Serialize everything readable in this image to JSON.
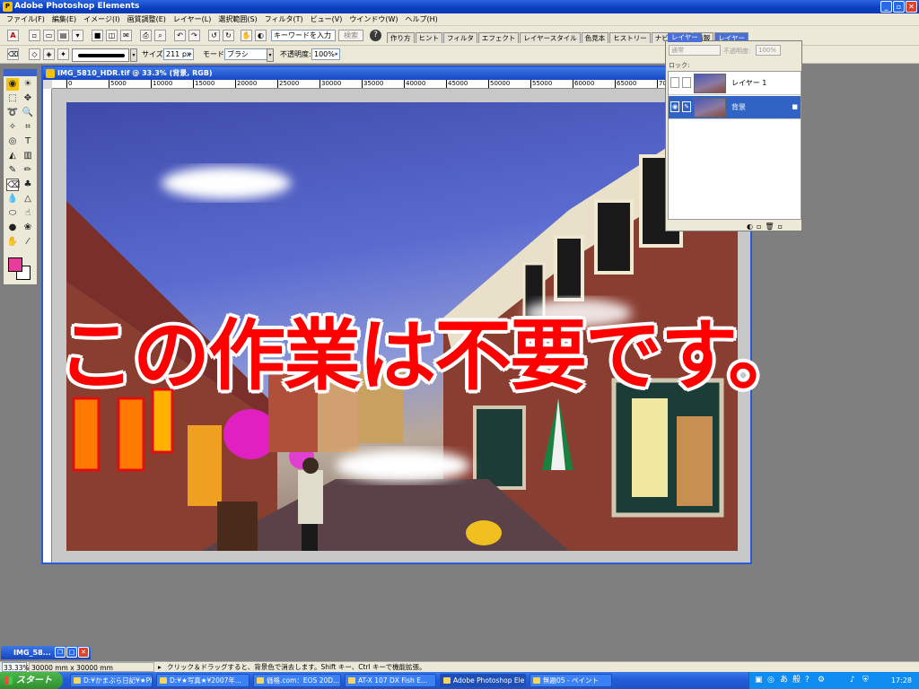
{
  "app": {
    "title": "Adobe Photoshop Elements"
  },
  "menu": [
    "ファイル(F)",
    "編集(E)",
    "イメージ(I)",
    "画質調整(E)",
    "レイヤー(L)",
    "選択範囲(S)",
    "フィルタ(T)",
    "ビュー(V)",
    "ウインドウ(W)",
    "ヘルプ(H)"
  ],
  "toolbar": {
    "search_placeholder": "キーワードを入力",
    "search_button": "検索",
    "help": "?"
  },
  "palette_tabs": [
    "作り方",
    "ヒント",
    "フィルタ",
    "エフェクト",
    "レイヤースタイル",
    "色見本",
    "ヒストリー",
    "ナビゲータ",
    "情報",
    "レイヤー"
  ],
  "options": {
    "size_label": "サイズ:",
    "size_value": "211 px",
    "mode_label": "モード:",
    "mode_value": "ブラシ",
    "opacity_label": "不透明度:",
    "opacity_value": "100%"
  },
  "document": {
    "title": "IMG_5810_HDR.tif @ 33.3% (背景, RGB)",
    "ruler_ticks": [
      "0",
      "5000",
      "10000",
      "15000",
      "20000",
      "25000",
      "30000",
      "35000",
      "40000",
      "45000",
      "50000",
      "55000",
      "60000",
      "65000",
      "70000",
      "75000"
    ]
  },
  "layers_palette": {
    "tab": "レイヤー",
    "blend_mode": "通常",
    "opacity_label": "不透明度:",
    "opacity_value": "100%",
    "lock_label": "ロック:",
    "layers": [
      {
        "name": "レイヤー 1",
        "selected": false
      },
      {
        "name": "背景",
        "selected": true
      }
    ]
  },
  "overlay_text": "この作業は不要です。",
  "minimized_doc": {
    "title": "IMG_58..."
  },
  "statusbar": {
    "zoom": "33.33%",
    "doc_size": "30000 mm x 30000 mm",
    "hint": "クリック＆ドラッグすると、背景色で消去します。Shift キー、Ctrl キーで機能拡張。"
  },
  "taskbar": {
    "start": "スタート",
    "tasks": [
      "D:¥かまぶら日記¥★Ph...",
      "D:¥★写真★¥2007年...",
      "価格.com：EOS 20D...",
      "AT-X 107 DX Fish E...",
      "Adobe Photoshop Ele...",
      "無題05 - ペイント"
    ],
    "active_task_index": 4,
    "clock": "17:28"
  },
  "colors": {
    "foreground": "#e83c9a",
    "background": "#ffffff",
    "overlay": "#ff0000"
  }
}
